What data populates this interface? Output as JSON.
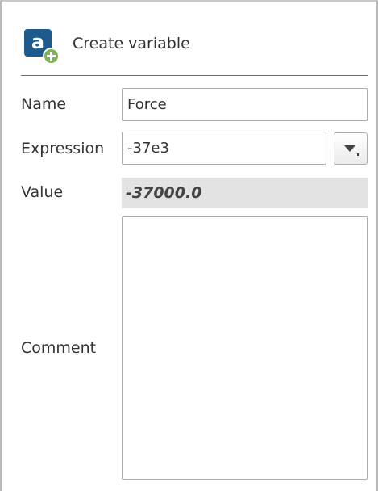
{
  "dialog": {
    "title": "Create variable",
    "icon": "create-variable-icon"
  },
  "form": {
    "name_label": "Name",
    "name_value": "Force",
    "expression_label": "Expression",
    "expression_value": "-37e3",
    "value_label": "Value",
    "value_value": "-37000.0",
    "comment_label": "Comment",
    "comment_value": ""
  },
  "colors": {
    "icon_tile": "#1f5a8c",
    "icon_plus": "#7ab648",
    "value_background": "#e3e3e3"
  }
}
